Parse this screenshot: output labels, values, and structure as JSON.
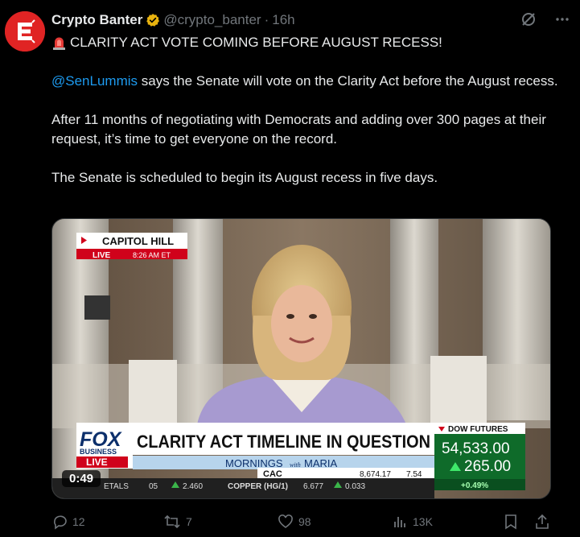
{
  "author": {
    "display_name": "Crypto Banter",
    "handle": "@crypto_banter",
    "separator": "·",
    "time": "16h",
    "avatar_icon": "crypto-banter-logo-icon",
    "verified_icon": "gold-verified-badge-icon"
  },
  "tweet": {
    "headline": "CLARITY ACT VOTE COMING BEFORE AUGUST RECESS!",
    "mention": "@SenLummis",
    "para1_rest": " says the Senate will vote on the Clarity Act before the August recess.",
    "para2": "After 11 months of negotiating with Democrats and adding over 300 pages at their request, it’s time to get everyone on the record.",
    "para3": "The Senate is scheduled to begin its August recess in five days."
  },
  "video": {
    "duration": "0:49",
    "location_tag": "CAPITOL HILL",
    "live_label": "LIVE",
    "live_time": "8:26 AM ET",
    "network_top": "FOX",
    "network_bottom": "BUSINESS",
    "network_live": "LIVE",
    "lower_third": "CLARITY ACT TIMELINE IN QUESTION",
    "show_name": "MORNINGS",
    "show_with": "with",
    "show_host": "MARIA",
    "ticker_mid_1": "CAC",
    "ticker_mid_2": "8,674.17",
    "ticker_mid_3": "7.54",
    "ticker_metals": "ETALS",
    "ticker_val_1": "05",
    "ticker_val_2": "2.460",
    "ticker_copper": "COPPER (HG/1)",
    "ticker_val_3": "6.677",
    "ticker_val_4": "0.033",
    "dow_label": "DOW FUTURES",
    "dow_value": "54,533.00",
    "dow_change": "265.00",
    "dow_pct": "+0.49%"
  },
  "actions": {
    "replies": "12",
    "reposts": "7",
    "likes": "98",
    "views": "13K"
  },
  "colors": {
    "background": "#000000",
    "text": "#e7e9ea",
    "muted": "#71767b",
    "link": "#1d9bf0",
    "brand_red": "#e02424",
    "gold": "#f4b400"
  }
}
